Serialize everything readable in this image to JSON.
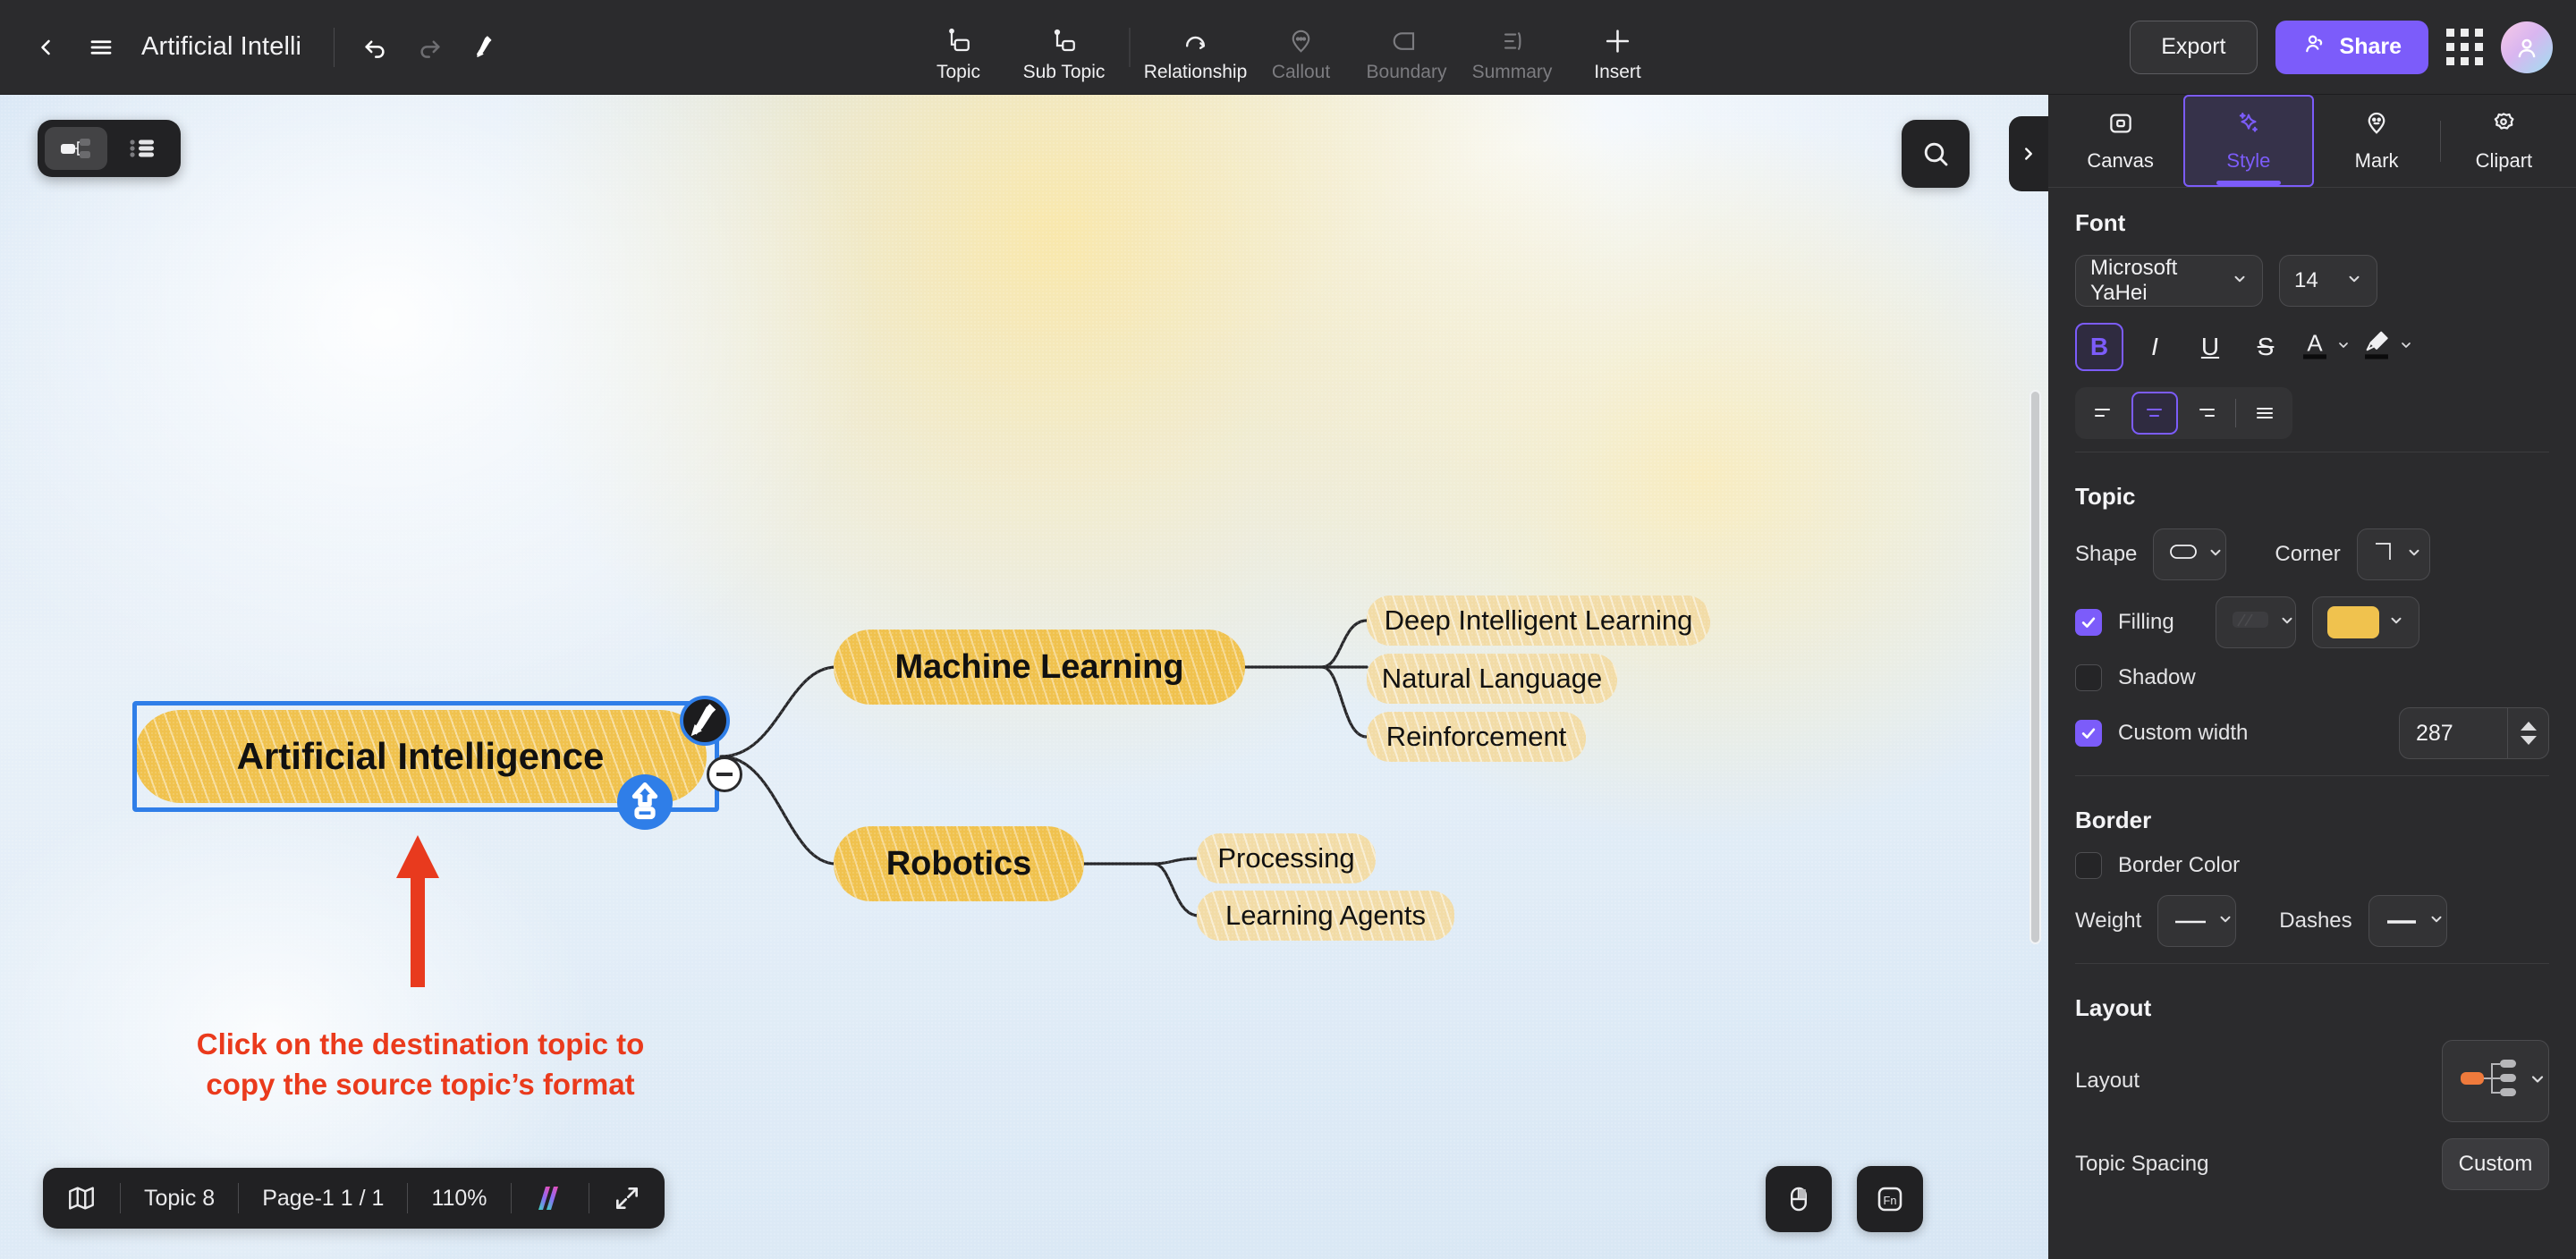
{
  "topbar": {
    "back_icon": "chevron-left-icon",
    "menu_icon": "hamburger-menu-icon",
    "doc_title": "Artificial Intelli",
    "undo_icon": "undo-icon",
    "redo_icon": "redo-icon",
    "format_painter_icon": "format-painter-icon",
    "tools": [
      {
        "label": "Topic",
        "icon": "topic-icon",
        "disabled": false
      },
      {
        "label": "Sub Topic",
        "icon": "sub-topic-icon",
        "disabled": false
      },
      {
        "label": "Relationship",
        "icon": "relationship-icon",
        "disabled": false
      },
      {
        "label": "Callout",
        "icon": "callout-icon",
        "disabled": true
      },
      {
        "label": "Boundary",
        "icon": "boundary-icon",
        "disabled": true
      },
      {
        "label": "Summary",
        "icon": "summary-icon",
        "disabled": true
      },
      {
        "label": "Insert",
        "icon": "plus-icon",
        "disabled": false
      }
    ],
    "export_label": "Export",
    "share_label": "Share",
    "apps_icon": "apps-grid-icon",
    "avatar_icon": "user-avatar"
  },
  "canvas": {
    "view_toggle": {
      "map_view_icon": "mindmap-view-icon",
      "outline_view_icon": "outline-view-icon"
    },
    "search_icon": "search-icon",
    "panel_collapse_icon": "chevron-right-icon",
    "scrollbar": "vertical-scrollbar",
    "annotation": {
      "line1": "Click on the destination topic to",
      "line2": "copy the source topic’s format",
      "color": "#ea3a1c",
      "arrow_icon": "up-arrow-annotation"
    },
    "selection": {
      "brush_badge_icon": "format-painter-badge-icon",
      "promote_badge_icon": "upload-badge-icon",
      "collapse_badge_icon": "collapse-minus-icon"
    }
  },
  "mindmap": {
    "root": {
      "label": "Artificial Intelligence",
      "fill": "#f0c24e",
      "selected": true
    },
    "branches": [
      {
        "label": "Machine Learning",
        "fill": "#f0c24e",
        "children": [
          "Deep Intelligent Learning",
          "Natural Language",
          "Reinforcement"
        ]
      },
      {
        "label": "Robotics",
        "fill": "#f0c24e",
        "children": [
          "Processing",
          "Learning Agents"
        ]
      }
    ],
    "leaf_fill": "#f2dca7"
  },
  "statusbar": {
    "map_icon": "map-outline-icon",
    "topic_count": "Topic 8",
    "page_label": "Page‑1  1 / 1",
    "zoom": "110%",
    "ai_icon": "ai-assistant-icon",
    "fullscreen_icon": "fullscreen-icon",
    "mouse_icon": "mouse-mode-icon",
    "fn_icon": "fn-key-icon"
  },
  "panel": {
    "tabs": [
      {
        "label": "Canvas",
        "icon": "canvas-icon",
        "active": false
      },
      {
        "label": "Style",
        "icon": "sparkle-icon",
        "active": true
      },
      {
        "label": "Mark",
        "icon": "mark-pin-icon",
        "active": false
      },
      {
        "label": "Clipart",
        "icon": "clipart-icon",
        "active": false
      }
    ],
    "font": {
      "title": "Font",
      "family": "Microsoft YaHei",
      "size": "14",
      "bold_label": "B",
      "italic_label": "I",
      "underline_label": "U",
      "strike_label": "S",
      "text_color_icon": "text-color-icon",
      "highlight_icon": "highlighter-icon",
      "bold_active": true,
      "align_icons": [
        "align-left-icon",
        "align-center-icon",
        "align-right-icon",
        "align-justify-icon"
      ],
      "align_active_index": 1
    },
    "topic": {
      "title": "Topic",
      "shape_label": "Shape",
      "shape_icon": "rounded-rect-shape-icon",
      "corner_label": "Corner",
      "corner_icon": "square-corner-icon",
      "filling_label": "Filling",
      "filling_checked": true,
      "fill_pattern_icon": "fill-pattern-icon",
      "fill_color": "#f0c24e",
      "shadow_label": "Shadow",
      "shadow_checked": false,
      "custom_width_label": "Custom width",
      "custom_width_checked": true,
      "custom_width_value": "287"
    },
    "border": {
      "title": "Border",
      "border_color_label": "Border Color",
      "border_color_checked": false,
      "weight_label": "Weight",
      "weight_icon": "solid-line-icon",
      "dashes_label": "Dashes",
      "dashes_icon": "solid-dash-icon"
    },
    "layout": {
      "title": "Layout",
      "layout_label": "Layout",
      "layout_icon": "right-tree-layout-icon",
      "spacing_label": "Topic Spacing",
      "spacing_value": "Custom"
    }
  }
}
